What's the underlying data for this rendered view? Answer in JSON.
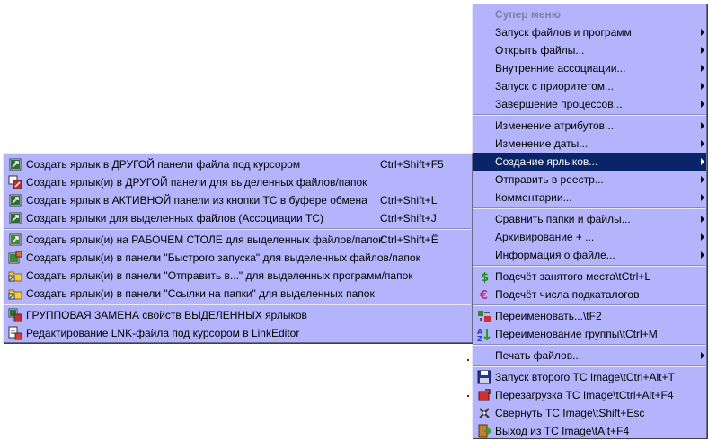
{
  "main_menu": {
    "items": [
      {
        "type": "header",
        "label": "Супер меню"
      },
      {
        "type": "item",
        "label": "Запуск файлов и программ",
        "submenu": true
      },
      {
        "type": "item",
        "label": "Открыть файлы...",
        "submenu": true
      },
      {
        "type": "item",
        "label": "Внутренние ассоциации...",
        "submenu": true
      },
      {
        "type": "item",
        "label": "Запуск с приоритетом...",
        "submenu": true
      },
      {
        "type": "item",
        "label": "Завершение процессов...",
        "submenu": true
      },
      {
        "type": "sep"
      },
      {
        "type": "item",
        "label": "Изменение атрибутов...",
        "submenu": true
      },
      {
        "type": "item",
        "label": "Изменение даты...",
        "submenu": true
      },
      {
        "type": "item",
        "label": "Создание ярлыков...",
        "submenu": true,
        "highlighted": true
      },
      {
        "type": "item",
        "label": "Отправить в реестр...",
        "submenu": true
      },
      {
        "type": "item",
        "label": "Комментарии...",
        "submenu": true
      },
      {
        "type": "sep"
      },
      {
        "type": "item",
        "label": "Сравнить папки и файлы...",
        "submenu": true
      },
      {
        "type": "item",
        "label": "Архивирование + ...",
        "submenu": true
      },
      {
        "type": "item",
        "label": "Информация о файле...",
        "submenu": true
      },
      {
        "type": "sep"
      },
      {
        "type": "item",
        "label": "Подсчёт занятого места\\tCtrl+L",
        "icon": "dollar-icon"
      },
      {
        "type": "item",
        "label": "Подсчёт числа подкаталогов",
        "icon": "euro-icon"
      },
      {
        "type": "sep"
      },
      {
        "type": "item",
        "label": "Переименовать...\\tF2",
        "icon": "rename-icon"
      },
      {
        "type": "item",
        "label": "Переименование группы\\tCtrl+M",
        "icon": "sort-az-icon"
      },
      {
        "type": "sep"
      },
      {
        "type": "item",
        "label": "Печать файлов...",
        "submenu": true
      },
      {
        "type": "sep"
      },
      {
        "type": "item",
        "label": "Запуск второго TC Image\\tCtrl+Alt+T",
        "icon": "floppy-icon"
      },
      {
        "type": "item",
        "label": "Перезагрузка     TC Image\\tCtrl+Alt+F4",
        "icon": "restart-icon"
      },
      {
        "type": "item",
        "label": "Свернуть         TC Image\\tShift+Esc",
        "icon": "minimize-icon"
      },
      {
        "type": "item",
        "label": "Выход из         TC Image\\tAlt+F4",
        "icon": "exit-icon"
      }
    ]
  },
  "sub_menu": {
    "items": [
      {
        "type": "item",
        "label": "Создать ярлык в ДРУГОЙ панели файла под курсором",
        "shortcut": "Ctrl+Shift+F5",
        "icon": "shortcut-icon"
      },
      {
        "type": "item",
        "label": "Создать ярлык(и) в ДРУГОЙ панели для выделенных файлов/папок",
        "shortcut": "",
        "icon": "shortcut-multi-icon"
      },
      {
        "type": "item",
        "label": "Создать ярлык в АКТИВНОЙ панели из кнопки TC в буфере обмена",
        "shortcut": "Ctrl+Shift+L",
        "icon": "shortcut-icon"
      },
      {
        "type": "item",
        "label": "Создать ярлыки для выделенных файлов (Ассоциации TC)",
        "shortcut": "Ctrl+Shift+J",
        "icon": "shortcut-icon"
      },
      {
        "type": "sep"
      },
      {
        "type": "item",
        "label": "Создать ярлык(и) на РАБОЧЕМ СТОЛЕ для выделенных файлов/папок",
        "shortcut": "Ctrl+Shift+Ё",
        "icon": "desktop-shortcut-icon"
      },
      {
        "type": "item",
        "label": "Создать ярлык(и) в панели \"Быстрого запуска\" для выделенных файлов/папок",
        "shortcut": "",
        "icon": "quicklaunch-shortcut-icon"
      },
      {
        "type": "item",
        "label": "Создать ярлык(и) в панели \"Отправить в...\" для выделенных программ/папок",
        "shortcut": "",
        "icon": "folder-shortcut-icon"
      },
      {
        "type": "item",
        "label": "Создать ярлык(и) в панели \"Ссылки на папки\" для выделенных папок",
        "shortcut": "",
        "icon": "folder-shortcut-icon"
      },
      {
        "type": "sep"
      },
      {
        "type": "item",
        "label": "ГРУППОВАЯ ЗАМЕНА свойств ВЫДЕЛЕННЫХ ярлыков",
        "shortcut": "",
        "icon": "group-replace-icon"
      },
      {
        "type": "item",
        "label": "Редактирование LNK-файла под курсором в LinkEditor",
        "shortcut": "",
        "icon": "lnk-edit-icon"
      }
    ]
  },
  "colors": {
    "menu_bg": "#b4b4fc",
    "highlight_bg": "#0a246a",
    "header_text": "#7e7ea8"
  }
}
